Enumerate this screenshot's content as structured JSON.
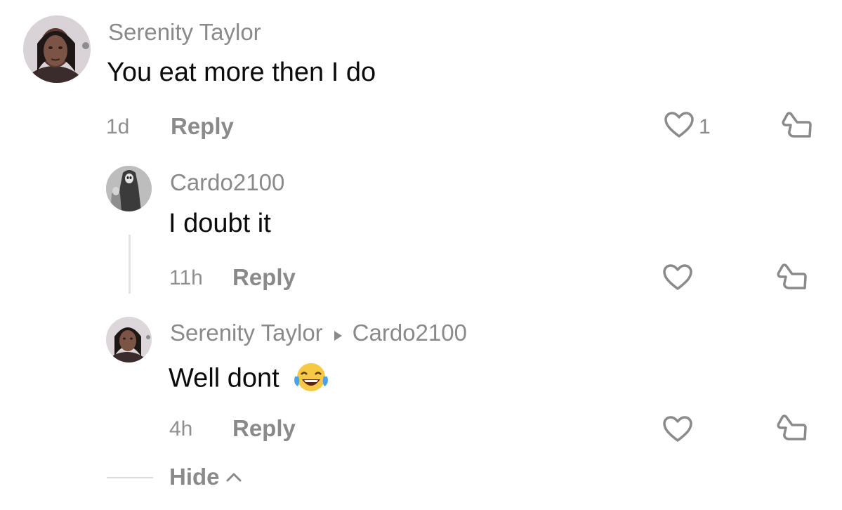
{
  "comments": [
    {
      "author": "Serenity Taylor",
      "text": "You eat more then I do",
      "time": "1d",
      "reply_label": "Reply",
      "like_count": "1"
    },
    {
      "author": "Cardo2100",
      "text": "I doubt it",
      "time": "11h",
      "reply_label": "Reply"
    },
    {
      "author": "Serenity Taylor",
      "reply_to": "Cardo2100",
      "text": "Well dont",
      "emoji": "😂",
      "time": "4h",
      "reply_label": "Reply"
    }
  ],
  "hide_label": "Hide",
  "colors": {
    "muted": "#8a8a8a",
    "text": "#0b0b0b",
    "icon": "#8a8a8a"
  },
  "icons": [
    "heart-outline-icon",
    "dislike-icon",
    "chevron-up-icon",
    "triangle-right-icon"
  ]
}
